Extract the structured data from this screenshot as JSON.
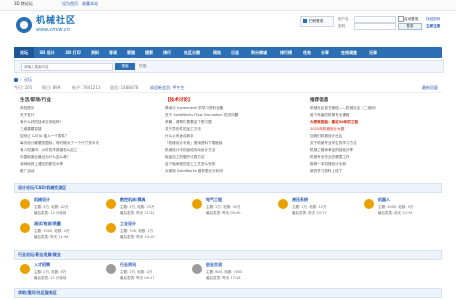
{
  "topbar": {
    "left_title": "3D 转论坛",
    "links": [
      "设为首页",
      "收藏本站"
    ]
  },
  "logo": {
    "main": "机械社区",
    "sub": "www.cmiw.cn"
  },
  "login": {
    "qr_label": "扫码登录",
    "user_placeholder": "用户名",
    "pass_placeholder": "密码",
    "remember": "自动登录",
    "forgot": "找回密码",
    "login_button": "登录",
    "register": "立即注册"
  },
  "nav": {
    "items": [
      "论坛",
      "3D 设计",
      "3D 打印",
      "资料",
      "导读",
      "家园",
      "搜索",
      "排行",
      "社区分期",
      "网站",
      "日志",
      "积分商城",
      "排行榜",
      "任务",
      "分享",
      "在线调查",
      "记录"
    ]
  },
  "search": {
    "placeholder": "请输入搜索内容",
    "button": "搜索",
    "hotwords_label": "热搜:"
  },
  "breadcrumb": {
    "items": [
      "论坛"
    ]
  },
  "stats": {
    "today": "今日: 205",
    "yesterday": "昨日: 899",
    "topics": "帖子: 7841213",
    "members": "会员: 1488478",
    "newest": "欢迎新会员: 甲午生",
    "right_link": "最新回复"
  },
  "columns": {
    "left": {
      "title": "生活/职场/行业",
      "items": [
        "风险提示",
        "关于发行",
        "有什么好的技术交流帖吗？",
        "三维建模答疑",
        "如何让 CATIA 插入一个零件？",
        "每次设计都要查国标，有时候为了一个尺寸查半天",
        "有人知道吗，小件的不锈钢怎么加工",
        "中国制造业最近为什么这么难？",
        "深圳地铁上遇见的那位大哥",
        "推广活动"
      ]
    },
    "middle": {
      "title": "【技术讨论】",
      "items": [
        "再续与 hypermesh 的学习资料全集",
        "关于 SolidWorks Flow Simulation 热流问题",
        "求解，请帮忙看看这个受力图",
        "关于异形件的加工方法",
        "什么公司适合新手",
        "「机械设计手册」常用资料下载链接",
        "机械设计中的齿轮传动设计方法",
        "钣金加工的展开计算方法",
        "这个轴承座的加工工艺怎么安排",
        "大家用 SolidWorks 做有限元分析吗"
      ]
    },
    "right": {
      "title": "推荐信息",
      "items": [
        "机械社区官方微信——机械社区（二维码）",
        "各个年级的机械专业课程",
        "大家来逛逛：最近30年的工程",
        "2025年机械设计大赛",
        "加我们机械设计社区",
        "关于机械专业学生的学习方法",
        "机械工程师考证的经验分享",
        "机械专业毕业去哪里工作",
        "推荐一本机械设计手册",
        "新的学习资料上线了"
      ]
    }
  },
  "sections": [
    {
      "title": "设计论坛/CAD/机械交流区",
      "forums": [
        {
          "name": "机械设计",
          "line1": "主题: 4万, 帖数: 42万",
          "line2": "最后发表: 12 分钟前",
          "color": "#e8a100"
        },
        {
          "name": "数控机床/模具",
          "line1": "主题: 1万, 帖数: 23万",
          "line2": "最后发表: 昨天 21:32",
          "color": "#e8a100"
        },
        {
          "name": "电气工程",
          "line1": "主题: 2万, 帖数: 35万",
          "line2": "最后发表: 昨天 00:40",
          "color": "#e8a100"
        },
        {
          "name": "液压系统",
          "line1": "主题: 1万, 帖数: 12万",
          "line2": "最后发表: 前天 23:17",
          "color": "#e8a100"
        },
        {
          "name": "机器人",
          "line1": "主题: 3000, 帖数: 5万",
          "line2": "最后发表: 前天 22:39",
          "color": "#e8a100"
        },
        {
          "name": "测试/检测/质量",
          "line1": "主题: 3000, 帖数: 4万",
          "line2": "最后发表: 昨天 11:56",
          "color": "#e8a100"
        },
        {
          "name": "工业设计",
          "line1": "主题: 700, 帖数: 1万",
          "line2": "最后发表: 昨天 10:10",
          "color": "#e8a100"
        }
      ]
    },
    {
      "title": "行业论坛/职业发展/就业",
      "forums": [
        {
          "name": "入才招聘",
          "line1": "主题: 2万, 帖数: 8万",
          "line2": "最后发表: 12 分钟前",
          "color": "#e8a100"
        },
        {
          "name": "行业资讯",
          "line1": "主题: 1万, 帖数: 4万",
          "line2": "最后发表: 昨天 00:17",
          "color": "#9b9b9b"
        },
        {
          "name": "创业交流",
          "line1": "主题: 600, 帖数: 7000",
          "line2": "最后发表: 昨天 17:28",
          "color": "#9b9b9b"
        }
      ]
    },
    {
      "title": "求助/提问/社区服务区",
      "forums": []
    }
  ]
}
